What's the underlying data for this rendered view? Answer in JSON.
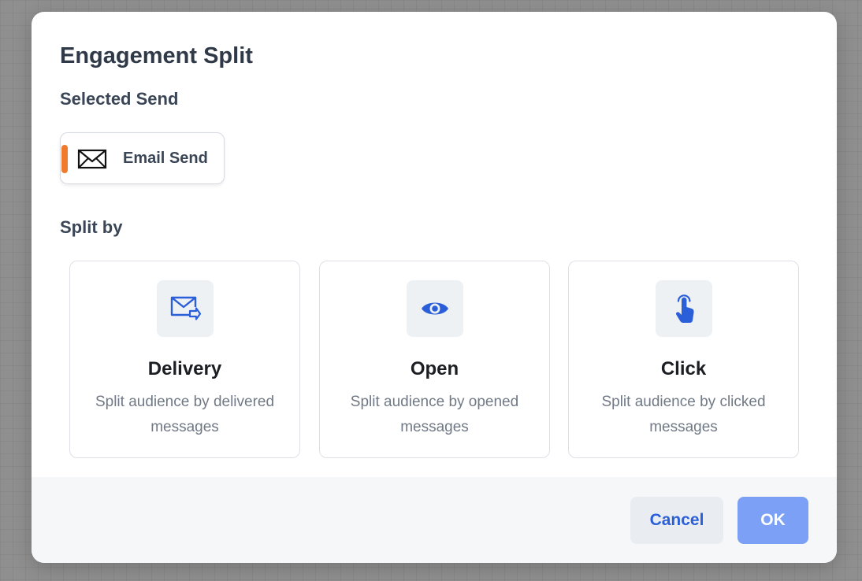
{
  "modal": {
    "title": "Engagement Split",
    "selected_send_label": "Selected Send",
    "split_by_label": "Split by"
  },
  "selected_send": {
    "label": "Email Send",
    "accent_color": "#f07a2d",
    "icon": "envelope-icon"
  },
  "options": [
    {
      "title": "Delivery",
      "description": "Split audience by delivered messages",
      "icon": "mail-forward-icon"
    },
    {
      "title": "Open",
      "description": "Split audience by opened messages",
      "icon": "eye-icon"
    },
    {
      "title": "Click",
      "description": "Split audience by clicked messages",
      "icon": "pointer-hand-icon"
    }
  ],
  "footer": {
    "cancel_label": "Cancel",
    "ok_label": "OK"
  },
  "colors": {
    "primary": "#2b5fd9",
    "ok_button": "#7ba0f5",
    "accent": "#f07a2d"
  }
}
